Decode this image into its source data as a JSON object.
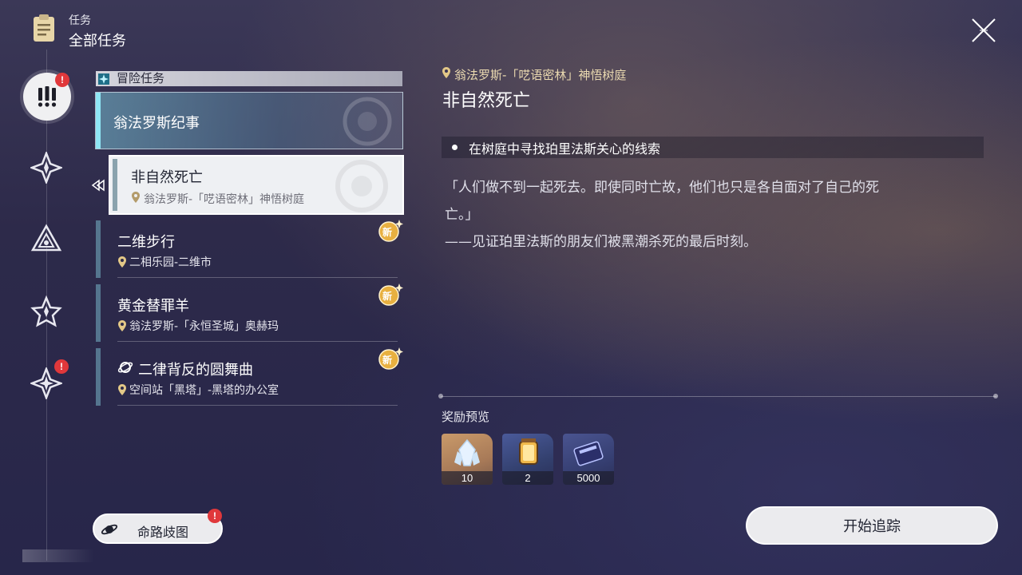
{
  "header": {
    "subtitle": "任务",
    "title": "全部任务"
  },
  "rail": {
    "badge_active": "!",
    "badge_bottom": "!"
  },
  "category": {
    "label": "冒险任务"
  },
  "group": {
    "label": "翁法罗斯纪事"
  },
  "selected_quest": {
    "title": "非自然死亡",
    "location": "翁法罗斯-「呓语密林」神悟树庭"
  },
  "quests": [
    {
      "title": "二维步行",
      "location": "二相乐园-二维市",
      "new_badge": "新"
    },
    {
      "title": "黄金替罪羊",
      "location": "翁法罗斯-「永恒圣城」奥赫玛",
      "new_badge": "新"
    },
    {
      "title": "二律背反的圆舞曲",
      "location": "空间站「黑塔」-黑塔的办公室",
      "new_badge": "新"
    }
  ],
  "map_button": {
    "label": "命路歧图",
    "badge": "!"
  },
  "detail": {
    "location": "翁法罗斯-「呓语密林」神悟树庭",
    "title": "非自然死亡",
    "objective": "在树庭中寻找珀里法斯关心的线索",
    "description_lines": [
      "「人们做不到一起死去。即使同时亡故，他们也只是各自面对了自己的死",
      "亡。」",
      "——见证珀里法斯的朋友们被黑潮杀死的最后时刻。"
    ]
  },
  "rewards": {
    "label": "奖励预览",
    "items": [
      {
        "icon": "crystal-icon",
        "count": "10"
      },
      {
        "icon": "lantern-icon",
        "count": "2"
      },
      {
        "icon": "pass-card-icon",
        "count": "5000"
      }
    ]
  },
  "track_button": {
    "label": "开始追踪"
  },
  "colors": {
    "accent_cyan": "#8fe6f5",
    "location_gold": "#ead9b0",
    "badge_red": "#e0383b",
    "new_badge_gold": "#e8b040"
  }
}
